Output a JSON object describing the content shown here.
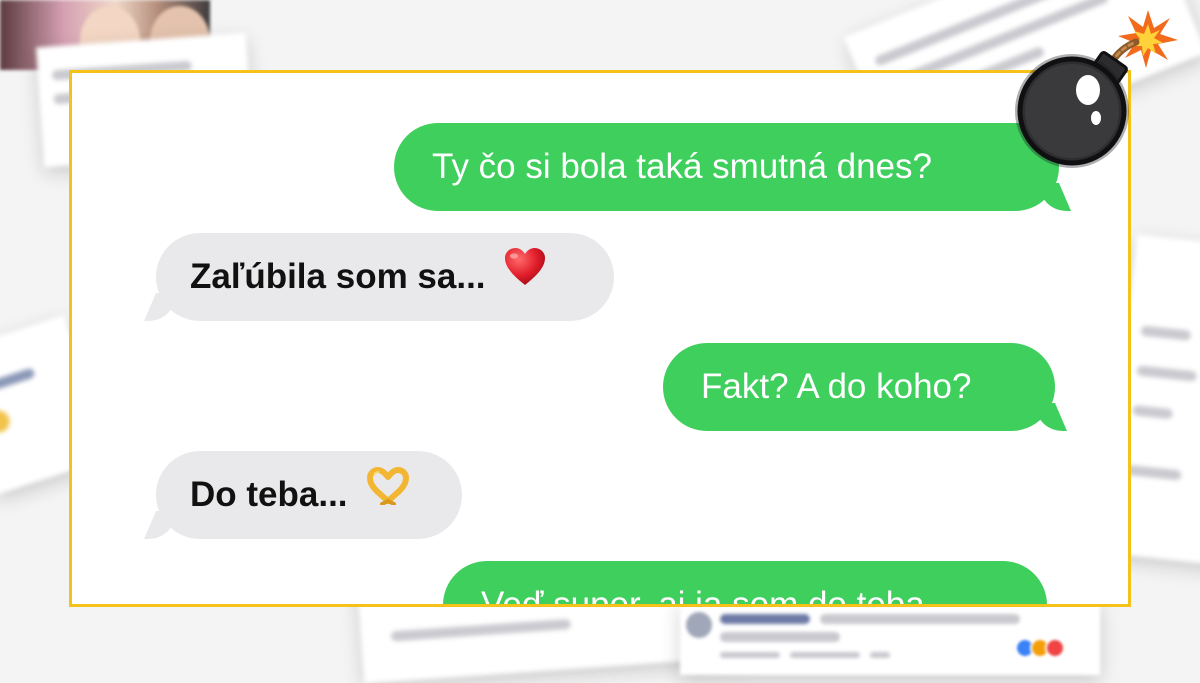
{
  "messages": [
    {
      "direction": "out",
      "text": "Ty čo si bola taká smutná dnes?"
    },
    {
      "direction": "in",
      "text": "Zaľúbila som sa...",
      "emoji": "red-heart-icon"
    },
    {
      "direction": "out",
      "text": "Fakt? A do koho?"
    },
    {
      "direction": "in",
      "text": "Do teba...",
      "emoji": "heart-hands-icon"
    },
    {
      "direction": "out",
      "text": "Veď super, ai ja som do teba"
    }
  ],
  "colors": {
    "frame_border": "#f5c21a",
    "outgoing_bubble": "#3ecf5d",
    "incoming_bubble": "#e9e9eb",
    "outgoing_text": "#ffffff",
    "incoming_text": "#111111"
  },
  "sticker": "bomb-icon"
}
